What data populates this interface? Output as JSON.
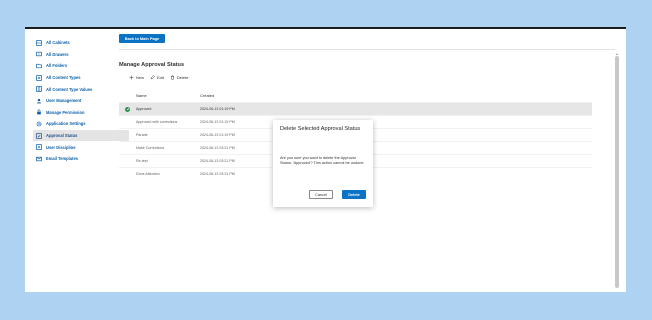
{
  "sidebar": {
    "items": [
      {
        "label": "All Cabinets",
        "icon": "cabinet-icon",
        "active": false
      },
      {
        "label": "All Drawers",
        "icon": "drawer-icon",
        "active": false
      },
      {
        "label": "All Folders",
        "icon": "folder-icon",
        "active": false
      },
      {
        "label": "All Content Types",
        "icon": "content-type-icon",
        "active": false
      },
      {
        "label": "All Content Type Values",
        "icon": "content-type-values-icon",
        "active": false
      },
      {
        "label": "User Management",
        "icon": "user-icon",
        "active": false
      },
      {
        "label": "Manage Permission",
        "icon": "lock-icon",
        "active": false
      },
      {
        "label": "Application Settings",
        "icon": "gear-icon",
        "active": false
      },
      {
        "label": "Approval Status",
        "icon": "approval-icon",
        "active": true
      },
      {
        "label": "User Discipline",
        "icon": "discipline-icon",
        "active": false
      },
      {
        "label": "Email Templates",
        "icon": "email-icon",
        "active": false
      }
    ]
  },
  "header": {
    "back_label": "Back to Main Page"
  },
  "main": {
    "title": "Manage Approval Status",
    "toolbar": {
      "new_label": "New",
      "edit_label": "Edit",
      "delete_label": "Delete"
    },
    "columns": {
      "name": "Name",
      "created": "Created"
    },
    "rows": [
      {
        "name": "Approved",
        "created": "2024-06-13 01:19 PM",
        "selected": true
      },
      {
        "name": "Approved with corrections",
        "created": "2024-06-13 01:19 PM",
        "selected": false
      },
      {
        "name": "Parade",
        "created": "2024-06-13 01:19 PM",
        "selected": false
      },
      {
        "name": "Make Corrections",
        "created": "2024-06-13 03:21 PM",
        "selected": false
      },
      {
        "name": "Re-test",
        "created": "2024-06-13 03:21 PM",
        "selected": false
      },
      {
        "name": "Done Attention",
        "created": "2024-06-13 03:21 PM",
        "selected": false
      }
    ]
  },
  "dialog": {
    "title": "Delete Selected Approval Status",
    "message": "Are you sure you want to delete the Approval Status: 'Approved'? This action cannot be undone.",
    "cancel_label": "Cancel",
    "delete_label": "Delete"
  },
  "colors": {
    "accent": "#0b73c6",
    "link": "#0b5fa8",
    "success": "#2a8f4e",
    "backdrop": "#aed3f2"
  }
}
